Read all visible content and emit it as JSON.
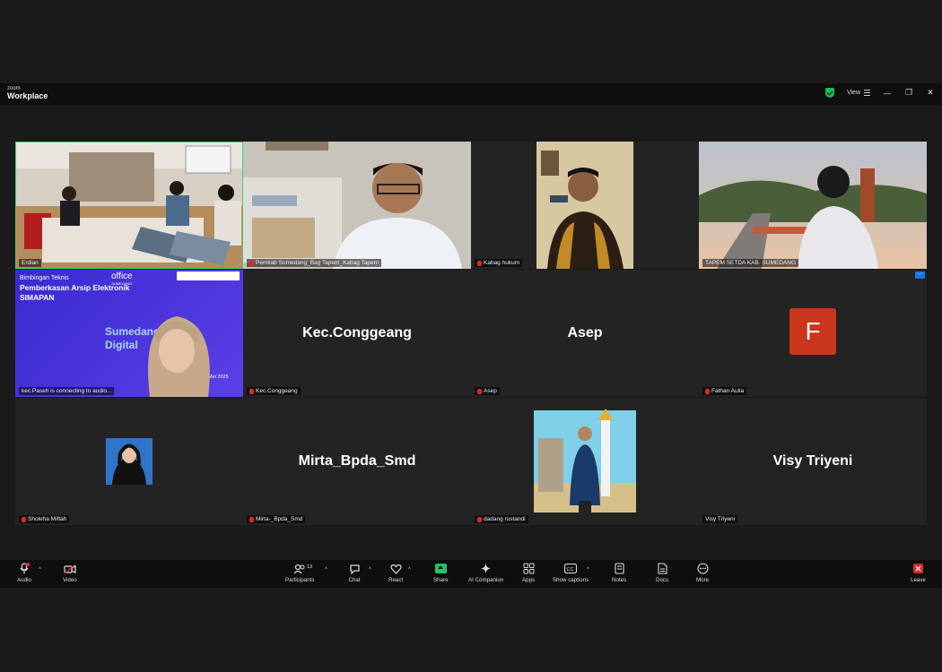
{
  "titlebar": {
    "brand_small": "zoom",
    "brand_big": "Workplace",
    "view_label": "View"
  },
  "tiles": [
    {
      "name": "Erdian",
      "muted": false,
      "type": "video"
    },
    {
      "name": "Pemkab Sumedang_Bag Tapem_Kabag Tapem",
      "muted": true,
      "type": "video"
    },
    {
      "name": "Kabag hukum",
      "muted": true,
      "type": "video"
    },
    {
      "name": "TAPEM SETDA KAB. SUMEDANG",
      "muted": false,
      "type": "video"
    },
    {
      "name": "kec.Paseh is connecting to audio...",
      "muted": false,
      "type": "video"
    },
    {
      "name": "Kec.Conggeang",
      "muted": true,
      "type": "name",
      "big": "Kec.Conggeang"
    },
    {
      "name": "Asep",
      "muted": true,
      "type": "name",
      "big": "Asep"
    },
    {
      "name": "Fathan Aulia",
      "muted": true,
      "type": "avatar",
      "initial": "F"
    },
    {
      "name": "Sholeha Miftah",
      "muted": true,
      "type": "photo"
    },
    {
      "name": "Mirta-_Bpda_Smd",
      "muted": true,
      "type": "name",
      "big": "Mirta_Bpda_Smd"
    },
    {
      "name": "dadang rustandi",
      "muted": true,
      "type": "photo"
    },
    {
      "name": "Visy Triyeni",
      "muted": false,
      "type": "name",
      "big": "Visy Triyeni"
    }
  ],
  "slide": {
    "line1": "Bimbingan Teknis",
    "line2": "Pemberkasan Arsip Elektronik",
    "line3": "SIMAPAN",
    "logo": "office",
    "logo_small": "SUMEDANG",
    "big1": "Sumedang Happy",
    "big2": "Digital",
    "date": "Mei 2025"
  },
  "toolbar": {
    "audio": "Audio",
    "video": "Video",
    "participants": "Participants",
    "participants_count": "13",
    "chat": "Chat",
    "react": "React",
    "share": "Share",
    "ai": "AI Companion",
    "apps": "Apps",
    "captions": "Show captions",
    "notes": "Notes",
    "docs": "Docs",
    "more": "More",
    "leave": "Leave"
  },
  "colors": {
    "active_border": "#3fd270",
    "share": "#1fc46a",
    "avatar": "#c9361b",
    "muted": "#e02828"
  }
}
